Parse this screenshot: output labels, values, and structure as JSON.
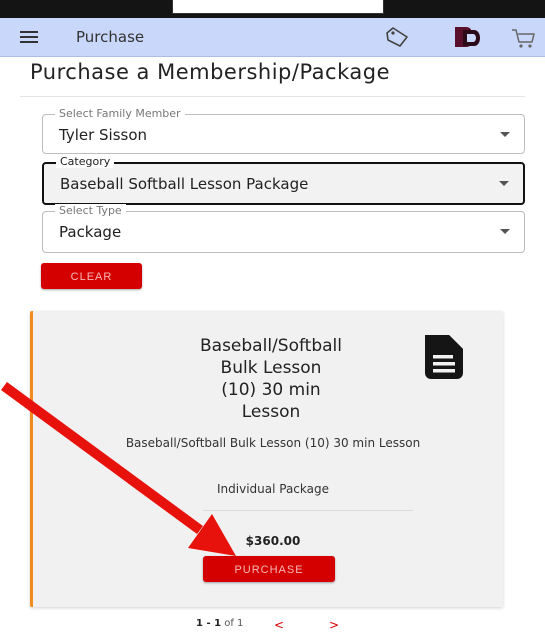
{
  "appbar": {
    "title": "Purchase",
    "icons": [
      "menu-icon",
      "tag-icon",
      "brand-logo-icon",
      "cart-icon"
    ]
  },
  "page": {
    "title": "Purchase a Membership/Package"
  },
  "filters": {
    "family_member": {
      "label": "Select Family Member",
      "value": "Tyler Sisson"
    },
    "category": {
      "label": "Category",
      "value": "Baseball Softball Lesson Package"
    },
    "type": {
      "label": "Select Type",
      "value": "Package"
    },
    "clear_label": "CLEAR"
  },
  "card": {
    "title_lines": [
      "Baseball/Softball",
      "Bulk Lesson",
      "(10) 30 min",
      "Lesson"
    ],
    "description": "Baseball/Softball Bulk Lesson (10) 30 min Lesson",
    "type": "Individual Package",
    "price": "$360.00",
    "purchase_label": "PURCHASE",
    "accent_color": "#f28b1e",
    "icon": "document-icon"
  },
  "pagination": {
    "range": "1 - 1",
    "of_label": "of 1",
    "prev": "<",
    "next": ">"
  },
  "colors": {
    "appbar": "#c9d7fa",
    "primary_button": "#d40000",
    "annotation_arrow": "#e8120c"
  }
}
